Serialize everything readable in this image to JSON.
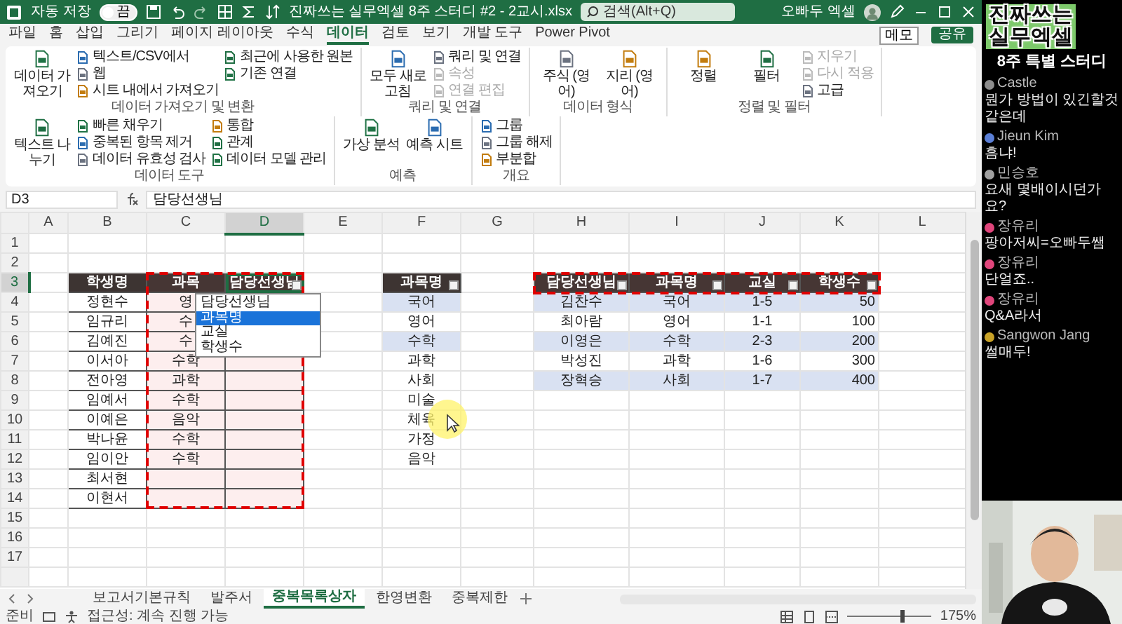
{
  "title_bar": {
    "autosave_label": "자동 저장",
    "autosave": {
      "on": false,
      "label": "끔"
    },
    "file_title": "진짜쓰는 실무엑셀 8주 스터디 #2 - 2교시.xlsx",
    "search": {
      "placeholder": "검색(Alt+Q)"
    },
    "user": "오빠두 엑셀"
  },
  "menu_tabs": [
    {
      "label": "파일",
      "selected": false
    },
    {
      "label": "홈",
      "selected": false
    },
    {
      "label": "삽입",
      "selected": false
    },
    {
      "label": "그리기",
      "selected": false
    },
    {
      "label": "페이지 레이아웃",
      "selected": false
    },
    {
      "label": "수식",
      "selected": false
    },
    {
      "label": "데이터",
      "selected": true
    },
    {
      "label": "검토",
      "selected": false
    },
    {
      "label": "보기",
      "selected": false
    },
    {
      "label": "개발 도구",
      "selected": false
    },
    {
      "label": "Power Pivot",
      "selected": false
    }
  ],
  "menu_buttons": {
    "memo": "메모",
    "share": "공유"
  },
  "ribbon": {
    "groups": [
      {
        "label": "데이터 가져오기 및 변환",
        "items": [
          {
            "kind": "large",
            "label": "데이터 가져오기",
            "disabled": false
          },
          {
            "kind": "small",
            "label": "텍스트/CSV에서",
            "disabled": false
          },
          {
            "kind": "small",
            "label": "웹",
            "disabled": false
          },
          {
            "kind": "small",
            "label": "시트 내에서 가져오기",
            "disabled": false
          },
          {
            "kind": "small",
            "label": "최근에 사용한 원본",
            "disabled": false
          },
          {
            "kind": "small",
            "label": "기존 연결",
            "disabled": false
          }
        ]
      },
      {
        "label": "쿼리 및 연결",
        "items": [
          {
            "kind": "large",
            "label": "모두 새로 고침",
            "disabled": false
          },
          {
            "kind": "small",
            "label": "쿼리 및 연결",
            "disabled": false
          },
          {
            "kind": "small",
            "label": "속성",
            "disabled": true
          },
          {
            "kind": "small",
            "label": "연결 편집",
            "disabled": true
          }
        ]
      },
      {
        "label": "데이터 형식",
        "items": [
          {
            "kind": "large",
            "label": "주식 (영어)",
            "disabled": false
          },
          {
            "kind": "large",
            "label": "지리 (영어)",
            "disabled": false
          }
        ]
      },
      {
        "label": "정렬 및 필터",
        "items": [
          {
            "kind": "large",
            "label": "정렬",
            "disabled": false
          },
          {
            "kind": "large",
            "label": "필터",
            "disabled": false
          },
          {
            "kind": "small",
            "label": "지우기",
            "disabled": true
          },
          {
            "kind": "small",
            "label": "다시 적용",
            "disabled": true
          },
          {
            "kind": "small",
            "label": "고급",
            "disabled": false
          }
        ]
      },
      {
        "label": "데이터 도구",
        "items": [
          {
            "kind": "large",
            "label": "텍스트 나누기",
            "disabled": false
          },
          {
            "kind": "small",
            "label": "빠른 채우기",
            "disabled": false
          },
          {
            "kind": "small",
            "label": "중복된 항목 제거",
            "disabled": false
          },
          {
            "kind": "small",
            "label": "데이터 유효성 검사",
            "disabled": false
          },
          {
            "kind": "small",
            "label": "통합",
            "disabled": false
          },
          {
            "kind": "small",
            "label": "관계",
            "disabled": false
          },
          {
            "kind": "small",
            "label": "데이터 모델 관리",
            "disabled": false
          }
        ]
      },
      {
        "label": "예측",
        "items": [
          {
            "kind": "large",
            "label": "가상 분석",
            "disabled": false
          },
          {
            "kind": "large",
            "label": "예측 시트",
            "disabled": false
          }
        ]
      },
      {
        "label": "개요",
        "items": [
          {
            "kind": "small",
            "label": "그룹",
            "disabled": false
          },
          {
            "kind": "small",
            "label": "그룹 해제",
            "disabled": false
          },
          {
            "kind": "small",
            "label": "부분합",
            "disabled": false
          }
        ]
      }
    ]
  },
  "formula_bar": {
    "name_box": "D3",
    "formula": "담당선생님"
  },
  "sheet": {
    "columns": [
      {
        "label": "A",
        "selected": false
      },
      {
        "label": "B",
        "selected": false
      },
      {
        "label": "C",
        "selected": false
      },
      {
        "label": "D",
        "selected": true
      },
      {
        "label": "E",
        "selected": false
      },
      {
        "label": "F",
        "selected": false
      },
      {
        "label": "G",
        "selected": false
      },
      {
        "label": "H",
        "selected": false
      },
      {
        "label": "I",
        "selected": false
      },
      {
        "label": "J",
        "selected": false
      },
      {
        "label": "K",
        "selected": false
      },
      {
        "label": "L",
        "selected": false
      }
    ],
    "rows": [
      {
        "label": "1",
        "selected": false
      },
      {
        "label": "2",
        "selected": false
      },
      {
        "label": "3",
        "selected": true,
        "cells": [
          null,
          {
            "kind": "header",
            "text": "학생명",
            "filter": false,
            "framed": false,
            "selected": false
          },
          {
            "kind": "header",
            "text": "과목",
            "filter": false,
            "framed": true,
            "selected": false
          },
          {
            "kind": "header",
            "text": "담당선생님",
            "filter": true,
            "framed": true,
            "selected": true
          },
          null,
          {
            "kind": "header",
            "text": "과목명",
            "filter": true,
            "framed": false,
            "selected": false
          },
          null,
          {
            "kind": "header",
            "text": "담당선생님",
            "filter": true,
            "framed": true,
            "selected": false
          },
          {
            "kind": "header",
            "text": "과목명",
            "filter": true,
            "framed": true,
            "selected": false
          },
          {
            "kind": "header",
            "text": "교실",
            "filter": true,
            "framed": true,
            "selected": false
          },
          {
            "kind": "header",
            "text": "학생수",
            "filter": true,
            "framed": true,
            "selected": false
          }
        ]
      },
      {
        "label": "4",
        "selected": false,
        "cells": [
          null,
          {
            "kind": "bordered",
            "text": "정현수",
            "framed": false
          },
          {
            "kind": "bordered",
            "text": "영",
            "framed": true
          },
          null,
          null,
          {
            "kind": "banded",
            "text": "국어",
            "shaded": true
          },
          null,
          {
            "kind": "banded",
            "text": "김찬수",
            "shaded": true
          },
          {
            "kind": "banded",
            "text": "국어",
            "shaded": true
          },
          {
            "kind": "banded",
            "text": "1-5",
            "shaded": true
          },
          {
            "kind": "number",
            "text": "50",
            "shaded": true
          }
        ]
      },
      {
        "label": "5",
        "selected": false,
        "cells": [
          null,
          {
            "kind": "bordered",
            "text": "임규리",
            "framed": false
          },
          {
            "kind": "bordered",
            "text": "수",
            "framed": true
          },
          null,
          null,
          {
            "kind": "banded",
            "text": "영어",
            "shaded": false
          },
          null,
          {
            "kind": "banded",
            "text": "최아람",
            "shaded": false
          },
          {
            "kind": "banded",
            "text": "영어",
            "shaded": false
          },
          {
            "kind": "banded",
            "text": "1-1",
            "shaded": false
          },
          {
            "kind": "number",
            "text": "100",
            "shaded": false
          }
        ]
      },
      {
        "label": "6",
        "selected": false,
        "cells": [
          null,
          {
            "kind": "bordered",
            "text": "김예진",
            "framed": false
          },
          {
            "kind": "bordered",
            "text": "수",
            "framed": true
          },
          {
            "kind": "bordered"
          },
          null,
          {
            "kind": "banded",
            "text": "수학",
            "shaded": true
          },
          null,
          {
            "kind": "banded",
            "text": "이영은",
            "shaded": true
          },
          {
            "kind": "banded",
            "text": "수학",
            "shaded": true
          },
          {
            "kind": "banded",
            "text": "2-3",
            "shaded": true
          },
          {
            "kind": "number",
            "text": "200",
            "shaded": true
          }
        ]
      },
      {
        "label": "7",
        "selected": false,
        "cells": [
          null,
          {
            "kind": "bordered",
            "text": "이서아",
            "framed": false
          },
          {
            "kind": "bordered",
            "text": "수학",
            "framed": true
          },
          {
            "kind": "bordered",
            "framed": true
          },
          null,
          {
            "kind": "banded",
            "text": "과학",
            "shaded": false
          },
          null,
          {
            "kind": "banded",
            "text": "박성진",
            "shaded": false
          },
          {
            "kind": "banded",
            "text": "과학",
            "shaded": false
          },
          {
            "kind": "banded",
            "text": "1-6",
            "shaded": false
          },
          {
            "kind": "number",
            "text": "300",
            "shaded": false
          }
        ]
      },
      {
        "label": "8",
        "selected": false,
        "cells": [
          null,
          {
            "kind": "bordered",
            "text": "전아영",
            "framed": false
          },
          {
            "kind": "bordered",
            "text": "과학",
            "framed": true
          },
          {
            "kind": "bordered",
            "framed": true
          },
          null,
          {
            "kind": "banded",
            "text": "사회",
            "shaded": false
          },
          null,
          {
            "kind": "banded",
            "text": "장혁승",
            "shaded": true
          },
          {
            "kind": "banded",
            "text": "사회",
            "shaded": true
          },
          {
            "kind": "banded",
            "text": "1-7",
            "shaded": true
          },
          {
            "kind": "number",
            "text": "400",
            "shaded": true
          }
        ]
      },
      {
        "label": "9",
        "selected": false,
        "cells": [
          null,
          {
            "kind": "bordered",
            "text": "임예서",
            "framed": false
          },
          {
            "kind": "bordered",
            "text": "수학",
            "framed": true
          },
          {
            "kind": "bordered",
            "framed": true
          },
          null,
          {
            "kind": "banded",
            "text": "미술",
            "shaded": false
          }
        ]
      },
      {
        "label": "10",
        "selected": false,
        "cells": [
          null,
          {
            "kind": "bordered",
            "text": "이예은",
            "framed": false
          },
          {
            "kind": "bordered",
            "text": "음악",
            "framed": true
          },
          {
            "kind": "bordered",
            "framed": true
          },
          null,
          {
            "kind": "banded",
            "text": "체육",
            "shaded": false,
            "pointer": true
          }
        ]
      },
      {
        "label": "11",
        "selected": false,
        "cells": [
          null,
          {
            "kind": "bordered",
            "text": "박나윤",
            "framed": false
          },
          {
            "kind": "bordered",
            "text": "수학",
            "framed": true
          },
          {
            "kind": "bordered",
            "framed": true
          },
          null,
          {
            "kind": "banded",
            "text": "가정",
            "shaded": false
          }
        ]
      },
      {
        "label": "12",
        "selected": false,
        "cells": [
          null,
          {
            "kind": "bordered",
            "text": "임이안",
            "framed": false
          },
          {
            "kind": "bordered",
            "text": "수학",
            "framed": true
          },
          {
            "kind": "bordered",
            "framed": true
          },
          null,
          {
            "kind": "banded",
            "text": "음악",
            "shaded": false
          }
        ]
      },
      {
        "label": "13",
        "selected": false,
        "cells": [
          null,
          {
            "kind": "bordered",
            "text": "최서현",
            "framed": false
          },
          {
            "kind": "bordered",
            "framed": true
          },
          {
            "kind": "bordered",
            "framed": true
          }
        ]
      },
      {
        "label": "14",
        "selected": false,
        "cells": [
          null,
          {
            "kind": "bordered",
            "text": "이현서",
            "framed": false
          },
          {
            "kind": "bordered",
            "framed": true
          },
          {
            "kind": "bordered",
            "framed": true
          }
        ]
      },
      {
        "label": "15",
        "selected": false
      },
      {
        "label": "16",
        "selected": false
      },
      {
        "label": "17",
        "selected": false
      }
    ],
    "dropdown": {
      "items": [
        {
          "label": "담당선생님",
          "selected": false
        },
        {
          "label": "과목명",
          "selected": true
        },
        {
          "label": "교실",
          "selected": false
        },
        {
          "label": "학생수",
          "selected": false
        }
      ]
    }
  },
  "sheet_tabs": [
    {
      "label": "보고서기본규칙",
      "selected": false
    },
    {
      "label": "발주서",
      "selected": false
    },
    {
      "label": "중복목록상자",
      "selected": true
    },
    {
      "label": "한영변환",
      "selected": false
    },
    {
      "label": "중복제한",
      "selected": false
    }
  ],
  "status_bar": {
    "mode": "준비",
    "accessibility": "접근성: 계속 진행 가능",
    "zoom": {
      "level": 0.62,
      "reading": "175%"
    }
  },
  "chat": {
    "logo": [
      "진짜쓰는",
      "실무엑셀"
    ],
    "subtitle": "8주 특별 스터디",
    "messages": [
      {
        "author": "Castle",
        "text": "뭔가 방법이 있긴할것같은데",
        "color": "#8c8c8c"
      },
      {
        "author": "Jieun Kim",
        "text": "흠냐!",
        "color": "#5b7fd6"
      },
      {
        "author": "민승호",
        "text": "요새 몇배이시던가요?",
        "color": "#a0a0a0"
      },
      {
        "author": "장유리",
        "text": "팡아저씨=오빠두쌤",
        "color": "#e0457b"
      },
      {
        "author": "장유리",
        "text": "단얼죠..",
        "color": "#e0457b"
      },
      {
        "author": "장유리",
        "text": "Q&A라서",
        "color": "#e0457b"
      },
      {
        "author": "Sangwon Jang",
        "text": "썰매두!",
        "color": "#c9a227"
      }
    ]
  }
}
